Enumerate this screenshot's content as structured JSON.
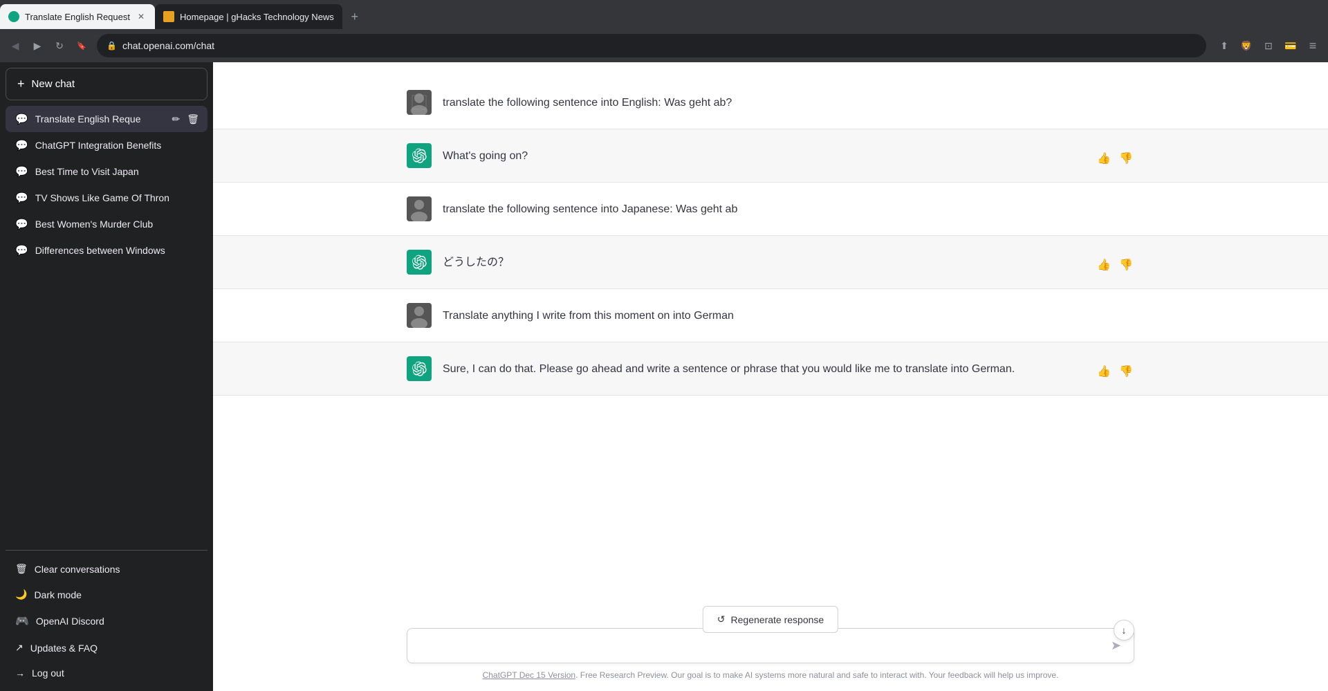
{
  "browser": {
    "tabs": [
      {
        "id": "tab1",
        "title": "Translate English Request",
        "favicon": "openai",
        "active": true
      },
      {
        "id": "tab2",
        "title": "Homepage | gHacks Technology News",
        "favicon": "ghacks",
        "active": false
      }
    ],
    "address": "chat.openai.com/chat"
  },
  "sidebar": {
    "new_chat_label": "New chat",
    "items": [
      {
        "id": "active",
        "label": "Translate English Reque",
        "active": true
      },
      {
        "id": "chatgpt",
        "label": "ChatGPT Integration Benefits",
        "active": false
      },
      {
        "id": "japan",
        "label": "Best Time to Visit Japan",
        "active": false
      },
      {
        "id": "tvshows",
        "label": "TV Shows Like Game Of Thron",
        "active": false
      },
      {
        "id": "murder",
        "label": "Best Women's Murder Club",
        "active": false
      },
      {
        "id": "windows",
        "label": "Differences between Windows",
        "active": false
      }
    ],
    "bottom_items": [
      {
        "id": "clear",
        "label": "Clear conversations",
        "icon": "trash"
      },
      {
        "id": "darkmode",
        "label": "Dark mode",
        "icon": "moon"
      },
      {
        "id": "discord",
        "label": "OpenAI Discord",
        "icon": "discord"
      },
      {
        "id": "updates",
        "label": "Updates & FAQ",
        "icon": "external"
      },
      {
        "id": "logout",
        "label": "Log out",
        "icon": "logout"
      }
    ]
  },
  "chat": {
    "messages": [
      {
        "id": "m1",
        "role": "user",
        "text": "translate the following sentence into English: Was geht ab?"
      },
      {
        "id": "m2",
        "role": "assistant",
        "text": "What's going on?"
      },
      {
        "id": "m3",
        "role": "user",
        "text": "translate the following sentence into Japanese: Was geht ab"
      },
      {
        "id": "m4",
        "role": "assistant",
        "text": "どうしたの？"
      },
      {
        "id": "m5",
        "role": "user",
        "text": "Translate anything I write from this moment on into German"
      },
      {
        "id": "m6",
        "role": "assistant",
        "text": "Sure, I can do that. Please go ahead and write a sentence or phrase that you would like me to translate into German."
      }
    ],
    "regenerate_label": "Regenerate response",
    "input_placeholder": "",
    "footer_link": "ChatGPT Dec 15 Version",
    "footer_text": ". Free Research Preview. Our goal is to make AI systems more natural and safe to interact with. Your feedback will help us improve."
  },
  "icons": {
    "plus": "+",
    "chat": "💬",
    "trash": "🗑",
    "moon": "🌙",
    "discord": "💬",
    "external": "↗",
    "logout": "→",
    "send": "➤",
    "thumbup": "👍",
    "thumbdown": "👎",
    "regenerate": "↺",
    "edit": "✏",
    "delete": "🗑",
    "scroll_down": "↓",
    "back": "◁",
    "forward": "▷",
    "reload": "↻",
    "bookmark": "🔖",
    "lock": "🔒",
    "share": "⬆",
    "brave": "🦁",
    "sidebar_toggle": "⊡",
    "wallet": "💳",
    "menu": "≡"
  }
}
